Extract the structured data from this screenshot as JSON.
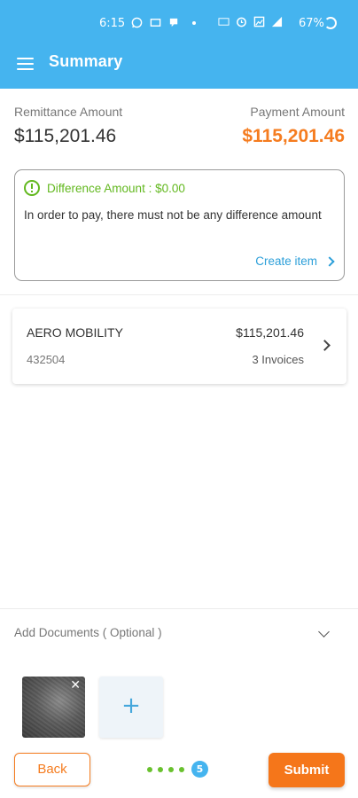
{
  "status_bar": {
    "time": "6:15",
    "battery": "67%",
    "icons": [
      "whatsapp-icon",
      "mail-icon",
      "chat-icon",
      "data-speed-icon",
      "alarm-icon",
      "gallery-icon",
      "signal-icon",
      "battery-icon"
    ]
  },
  "app_bar": {
    "title": "Summary",
    "background": "#45b4ef"
  },
  "amounts": {
    "remittance_label": "Remittance Amount",
    "remittance_value": "$115,201.46",
    "payment_label": "Payment Amount",
    "payment_value": "$115,201.46",
    "payment_color": "#f57c1f"
  },
  "difference_card": {
    "title": "Difference Amount : $0.00",
    "message": "In order to pay, there must not be any difference amount",
    "link_label": "Create item",
    "title_color": "#62b81e",
    "link_color": "#2c9fd9"
  },
  "vendor": {
    "name": "AERO MOBILITY",
    "id": "432504",
    "amount": "$115,201.46",
    "invoices": "3 Invoices"
  },
  "documents": {
    "label": "Add Documents ( Optional )",
    "add_symbol": "+",
    "remove_symbol": "✕"
  },
  "footer": {
    "back_label": "Back",
    "submit_label": "Submit",
    "current_step": "5",
    "completed_steps": 4
  }
}
